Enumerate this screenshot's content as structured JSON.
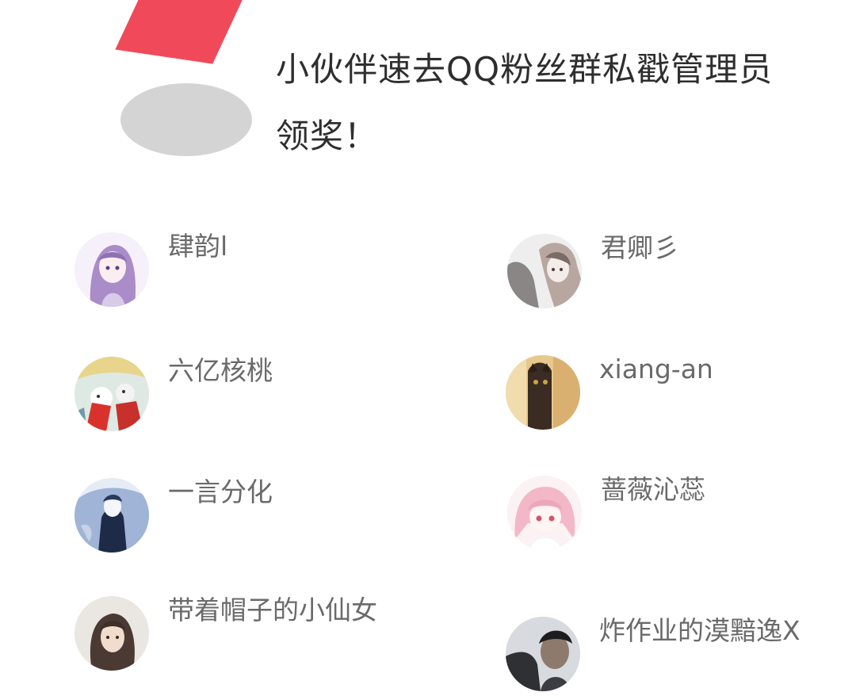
{
  "notice": {
    "line_1": "小伙伴速去QQ粉丝群私戳管理员",
    "line_2": "领奖！"
  },
  "winners": [
    {
      "name": "肆韵l",
      "avatar_icon": "anime-girl-purple-avatar-icon"
    },
    {
      "name": "君卿彡",
      "avatar_icon": "anime-couple-sketch-avatar-icon"
    },
    {
      "name": "六亿核桃",
      "avatar_icon": "cartoon-red-character-avatar-icon"
    },
    {
      "name": "xiang-an",
      "avatar_icon": "cat-peeking-avatar-icon"
    },
    {
      "name": "一言分化",
      "avatar_icon": "blue-sketch-avatar-icon"
    },
    {
      "name": "蔷薇沁蕊",
      "avatar_icon": "pink-hair-chibi-avatar-icon"
    },
    {
      "name": "带着帽子的小仙女",
      "avatar_icon": "girl-photo-avatar-icon"
    },
    {
      "name": "炸作业的漠黯逸X",
      "avatar_icon": "dark-photo-avatar-icon"
    }
  ],
  "colors": {
    "accent_red": "#f04a5a",
    "deco_gray": "#d4d4d4",
    "text_dark": "#2e2e2e",
    "text_name": "#6a6a6a"
  }
}
